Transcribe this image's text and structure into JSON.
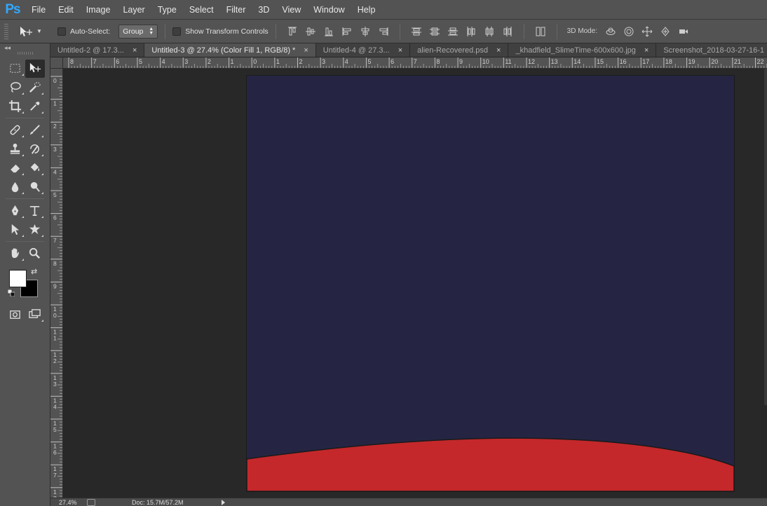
{
  "app": {
    "logo": "Ps",
    "menu": [
      "File",
      "Edit",
      "Image",
      "Layer",
      "Type",
      "Select",
      "Filter",
      "3D",
      "View",
      "Window",
      "Help"
    ]
  },
  "options": {
    "auto_select_label": "Auto-Select:",
    "auto_select_checked": false,
    "group_value": "Group",
    "show_transform_label": "Show Transform Controls",
    "show_transform_checked": false,
    "mode_3d_label": "3D Mode:"
  },
  "tabs": [
    {
      "title": "Untitled-2 @ 17.3...",
      "active": false,
      "closable": true
    },
    {
      "title": "Untitled-3 @ 27.4% (Color Fill 1, RGB/8) *",
      "active": true,
      "closable": true
    },
    {
      "title": "Untitled-4 @ 27.3...",
      "active": false,
      "closable": true
    },
    {
      "title": "alien-Recovered.psd",
      "active": false,
      "closable": true
    },
    {
      "title": "_khadfield_SlimeTime-600x600.jpg",
      "active": false,
      "closable": true
    },
    {
      "title": "Screenshot_2018-03-27-16-1",
      "active": false,
      "closable": false
    }
  ],
  "tab_close_glyph": "×",
  "ruler_h_labels": [
    "8",
    "7",
    "6",
    "5",
    "4",
    "3",
    "2",
    "1",
    "0",
    "1",
    "2",
    "3",
    "4",
    "5",
    "6",
    "7",
    "8",
    "9",
    "10",
    "11",
    "12",
    "13",
    "14",
    "15",
    "16",
    "17",
    "18",
    "19",
    "20",
    "21",
    "22"
  ],
  "ruler_v_labels": [
    "0",
    "1",
    "2",
    "3",
    "4",
    "5",
    "6",
    "7",
    "8",
    "9",
    "10",
    "11",
    "12",
    "13",
    "14",
    "15",
    "16",
    "17",
    "18"
  ],
  "colors": {
    "foreground": "#ffffff",
    "background": "#000000",
    "canvas_fill": "#252543",
    "shape_fill": "#c4282b",
    "shape_stroke": "#1a1a1a"
  },
  "status": {
    "zoom": "27.4%",
    "doc_info": "Doc: 15.7M/57.2M"
  }
}
